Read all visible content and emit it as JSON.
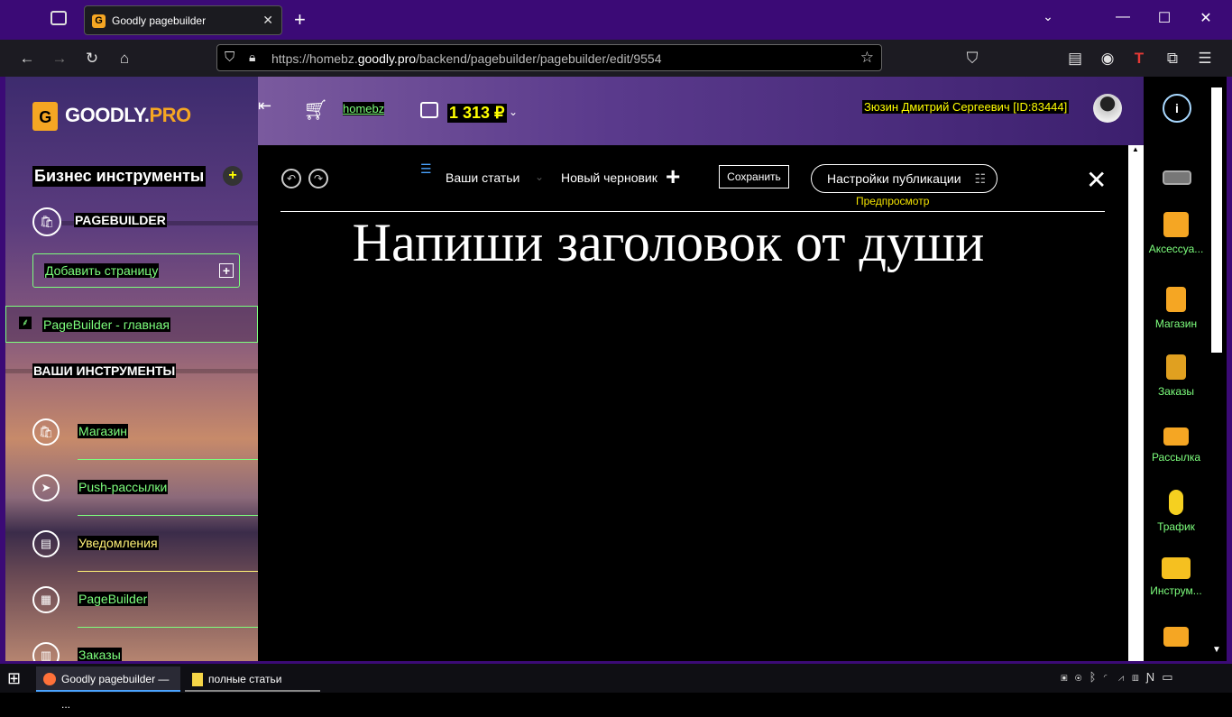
{
  "browser": {
    "tab_title": "Goodly pagebuilder",
    "tab_favicon": "G",
    "url_prefix": "https://homebz.",
    "url_domain": "goodly.pro",
    "url_path": "/backend/pagebuilder/pagebuilder/edit/9554"
  },
  "sidebar": {
    "logo_letter": "G",
    "logo_text": "GOODLY.",
    "logo_pro": "PRO",
    "business_tools": "Бизнес инструменты",
    "plus": "+",
    "pagebuilder_title": "PAGEBUILDER",
    "add_page": "Добавить страницу",
    "active_page": "PageBuilder - главная",
    "your_tools": "ВАШИ ИНСТРУМЕНТЫ",
    "items": [
      {
        "label": "Магазин",
        "icon": "bag-icon"
      },
      {
        "label": "Push-рассылки",
        "icon": "paper-plane-icon"
      },
      {
        "label": "Уведомления",
        "icon": "notification-icon"
      },
      {
        "label": "PageBuilder",
        "icon": "pagebuilder-icon"
      },
      {
        "label": "Заказы",
        "icon": "orders-icon"
      }
    ]
  },
  "header": {
    "username_link": "homebz",
    "balance": "1 313 ₽",
    "user": "Зюзин Дмитрий Сергеевич [ID:83444]"
  },
  "editor": {
    "articles": "Ваши статьи",
    "new_draft": "Новый черновик",
    "save": "Сохранить",
    "publish_settings": "Настройки публикации",
    "preview": "Предпросмотр",
    "heading": "Напиши заголовок от души"
  },
  "rightbar": {
    "info": "i",
    "items": [
      "Аксессуа...",
      "Магазин",
      "Заказы",
      "Рассылка",
      "Трафик",
      "Инструм..."
    ]
  },
  "taskbar": {
    "app1": "Goodly pagebuilder — ...",
    "app2": "полные статьи"
  },
  "colors": {
    "accent": "#f5a623",
    "frame": "#3b0a76",
    "green": "#7dff7d",
    "yellow": "#fff176"
  }
}
